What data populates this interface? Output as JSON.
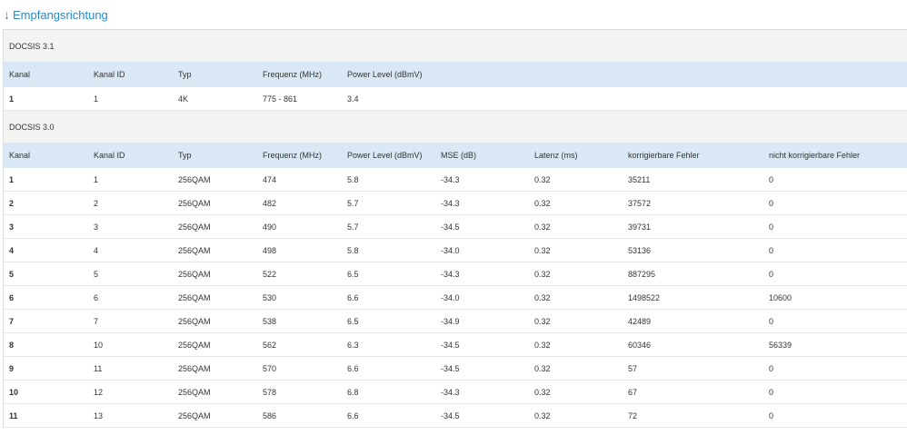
{
  "section": {
    "arrow": "↓",
    "title": "Empfangsrichtung"
  },
  "docsis31": {
    "title": "DOCSIS 3.1",
    "headers": [
      "Kanal",
      "Kanal ID",
      "Typ",
      "Frequenz (MHz)",
      "Power Level (dBmV)"
    ],
    "rows": [
      [
        "1",
        "1",
        "4K",
        "775 - 861",
        "3.4"
      ]
    ]
  },
  "docsis30": {
    "title": "DOCSIS 3.0",
    "headers": [
      "Kanal",
      "Kanal ID",
      "Typ",
      "Frequenz (MHz)",
      "Power Level (dBmV)",
      "MSE (dB)",
      "Latenz (ms)",
      "korrigierbare Fehler",
      "nicht korrigierbare Fehler"
    ],
    "rows": [
      [
        "1",
        "1",
        "256QAM",
        "474",
        "5.8",
        "-34.3",
        "0.32",
        "35211",
        "0"
      ],
      [
        "2",
        "2",
        "256QAM",
        "482",
        "5.7",
        "-34.3",
        "0.32",
        "37572",
        "0"
      ],
      [
        "3",
        "3",
        "256QAM",
        "490",
        "5.7",
        "-34.5",
        "0.32",
        "39731",
        "0"
      ],
      [
        "4",
        "4",
        "256QAM",
        "498",
        "5.8",
        "-34.0",
        "0.32",
        "53136",
        "0"
      ],
      [
        "5",
        "5",
        "256QAM",
        "522",
        "6.5",
        "-34.3",
        "0.32",
        "887295",
        "0"
      ],
      [
        "6",
        "6",
        "256QAM",
        "530",
        "6.6",
        "-34.0",
        "0.32",
        "1498522",
        "10600"
      ],
      [
        "7",
        "7",
        "256QAM",
        "538",
        "6.5",
        "-34.9",
        "0.32",
        "42489",
        "0"
      ],
      [
        "8",
        "10",
        "256QAM",
        "562",
        "6.3",
        "-34.5",
        "0.32",
        "60346",
        "56339"
      ],
      [
        "9",
        "11",
        "256QAM",
        "570",
        "6.6",
        "-34.5",
        "0.32",
        "57",
        "0"
      ],
      [
        "10",
        "12",
        "256QAM",
        "578",
        "6.8",
        "-34.3",
        "0.32",
        "67",
        "0"
      ],
      [
        "11",
        "13",
        "256QAM",
        "586",
        "6.6",
        "-34.5",
        "0.32",
        "72",
        "0"
      ]
    ]
  }
}
